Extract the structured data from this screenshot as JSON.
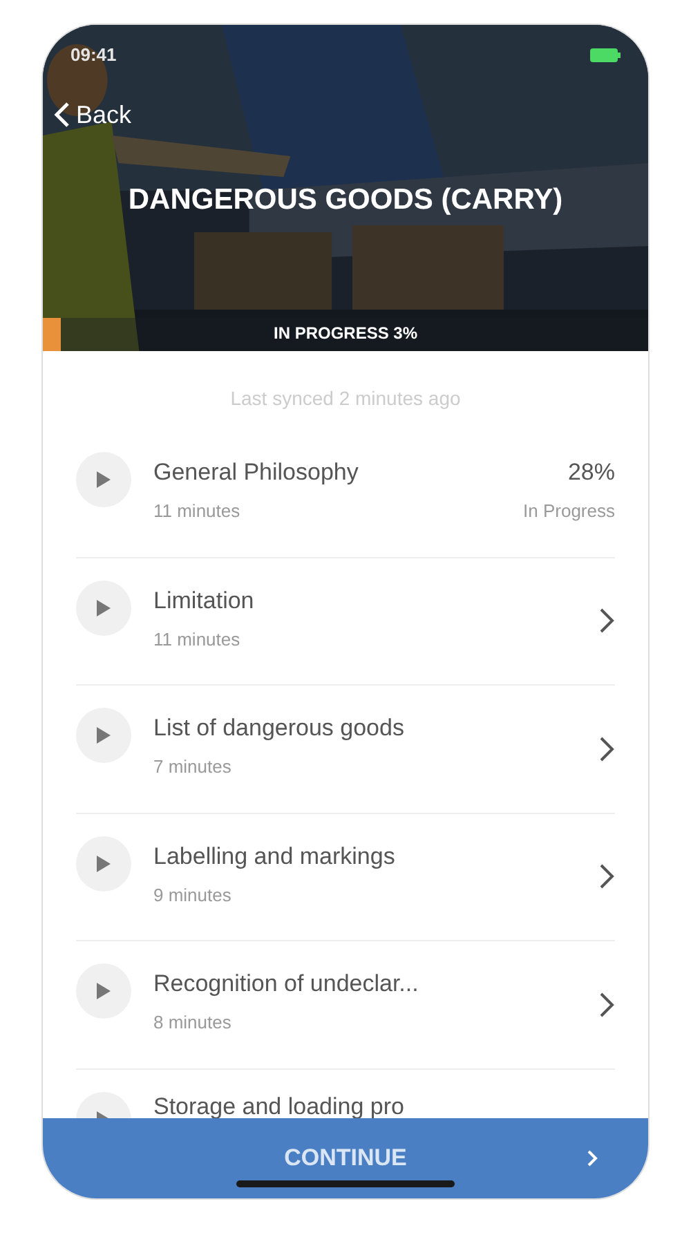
{
  "status_bar": {
    "time": "09:41"
  },
  "header": {
    "back": "Back",
    "title": "DANGEROUS GOODS (CARRY)",
    "progress_label": "IN PROGRESS 3%",
    "level": 0.03
  },
  "sync_note": "Last synced 2 minutes ago",
  "lessons": [
    {
      "kind": "progress",
      "title": "General Philosophy",
      "duration": "11 minutes",
      "percent": "28%",
      "status": "In Progress"
    },
    {
      "kind": "chevron",
      "title": "Limitation",
      "duration": "11 minutes"
    },
    {
      "kind": "chevron",
      "title": "List of dangerous goods",
      "duration": "7 minutes"
    },
    {
      "kind": "chevron",
      "title": "Labelling and markings",
      "duration": "9 minutes"
    },
    {
      "kind": "chevron",
      "title": "Recognition of undeclar...",
      "duration": "8 minutes"
    },
    {
      "kind": "partial",
      "title": "Storage and loading pro"
    }
  ],
  "continue_button": "CONTINUE"
}
